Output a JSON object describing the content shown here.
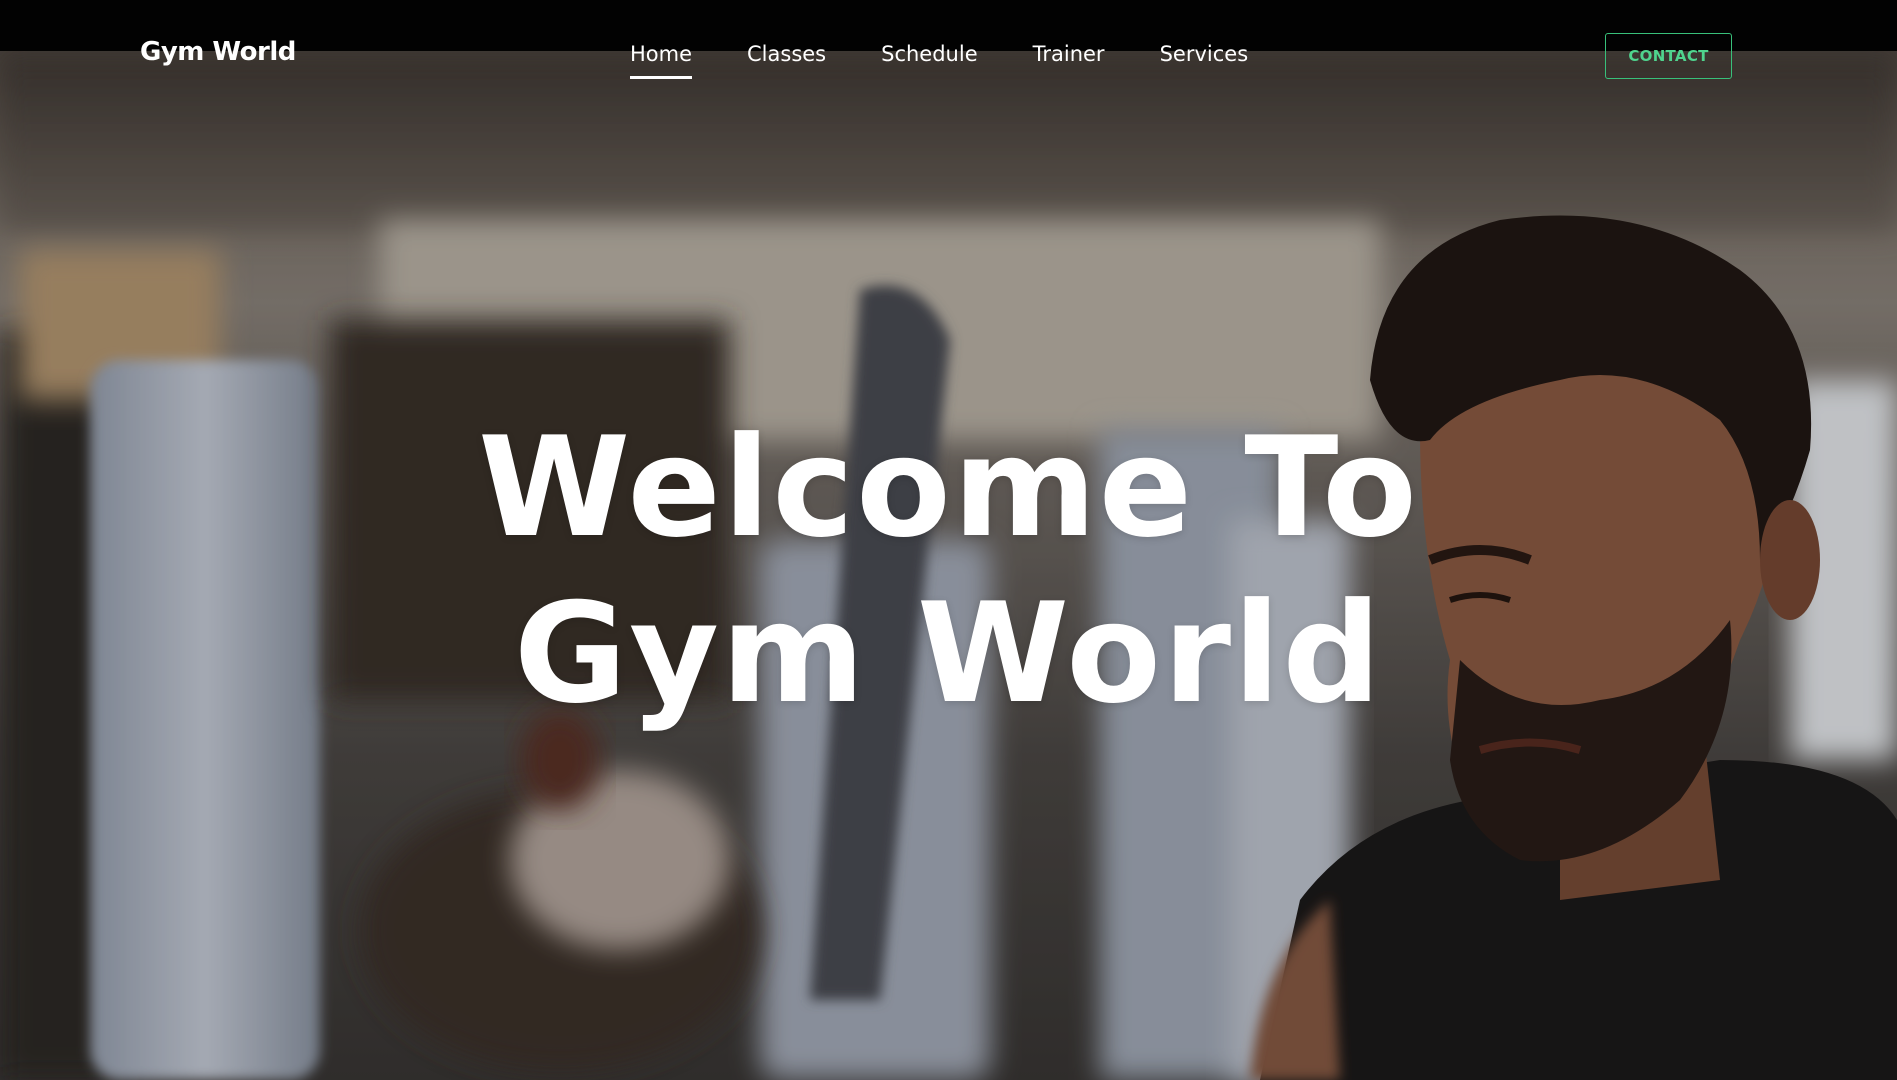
{
  "brand": {
    "name": "Gym World"
  },
  "nav": {
    "items": [
      {
        "label": "Home",
        "active": true
      },
      {
        "label": "Classes",
        "active": false
      },
      {
        "label": "Schedule",
        "active": false
      },
      {
        "label": "Trainer",
        "active": false
      },
      {
        "label": "Services",
        "active": false
      }
    ],
    "contact_label": "CONTACT"
  },
  "hero": {
    "line1": "Welcome To",
    "line2": "Gym World",
    "background": "gym-photo-man-working-out"
  },
  "colors": {
    "accent": "#38c07a",
    "text": "#ffffff",
    "topbar": "#020202"
  }
}
